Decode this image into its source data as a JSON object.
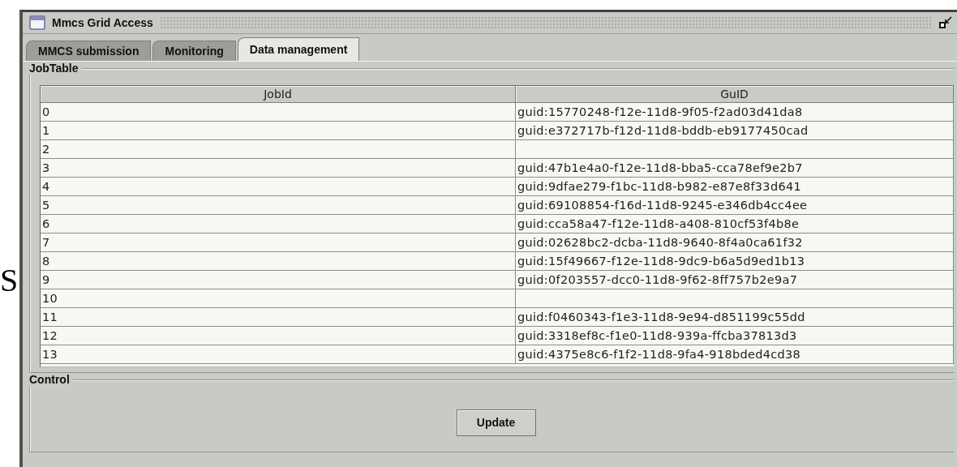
{
  "background_fragment": "S",
  "window": {
    "title": "Mmcs Grid Access"
  },
  "tabs": [
    {
      "label": "MMCS submission",
      "selected": false
    },
    {
      "label": "Monitoring",
      "selected": false
    },
    {
      "label": "Data management",
      "selected": true
    }
  ],
  "job_table": {
    "title": "JobTable",
    "columns": [
      "JobId",
      "GuID"
    ],
    "rows": [
      {
        "job_id": "0",
        "guid": "guid:15770248-f12e-11d8-9f05-f2ad03d41da8"
      },
      {
        "job_id": "1",
        "guid": "guid:e372717b-f12d-11d8-bddb-eb9177450cad"
      },
      {
        "job_id": "2"
      },
      {
        "job_id": "3",
        "guid": "guid:47b1e4a0-f12e-11d8-bba5-cca78ef9e2b7"
      },
      {
        "job_id": "4",
        "guid": "guid:9dfae279-f1bc-11d8-b982-e87e8f33d641"
      },
      {
        "job_id": "5",
        "guid": "guid:69108854-f16d-11d8-9245-e346db4cc4ee"
      },
      {
        "job_id": "6",
        "guid": "guid:cca58a47-f12e-11d8-a408-810cf53f4b8e"
      },
      {
        "job_id": "7",
        "guid": "guid:02628bc2-dcba-11d8-9640-8f4a0ca61f32"
      },
      {
        "job_id": "8",
        "guid": "guid:15f49667-f12e-11d8-9dc9-b6a5d9ed1b13"
      },
      {
        "job_id": "9",
        "guid": "guid:0f203557-dcc0-11d8-9f62-8ff757b2e9a7"
      },
      {
        "job_id": "10"
      },
      {
        "job_id": "11",
        "guid": "guid:f0460343-f1e3-11d8-9e94-d851199c55dd"
      },
      {
        "job_id": "12",
        "guid": "guid:3318ef8c-f1e0-11d8-939a-ffcba37813d3"
      },
      {
        "job_id": "13",
        "guid": "guid:4375e8c6-f1f2-11d8-9fa4-918bded4cd38"
      }
    ]
  },
  "control": {
    "title": "Control",
    "buttons": [
      "Update"
    ]
  }
}
